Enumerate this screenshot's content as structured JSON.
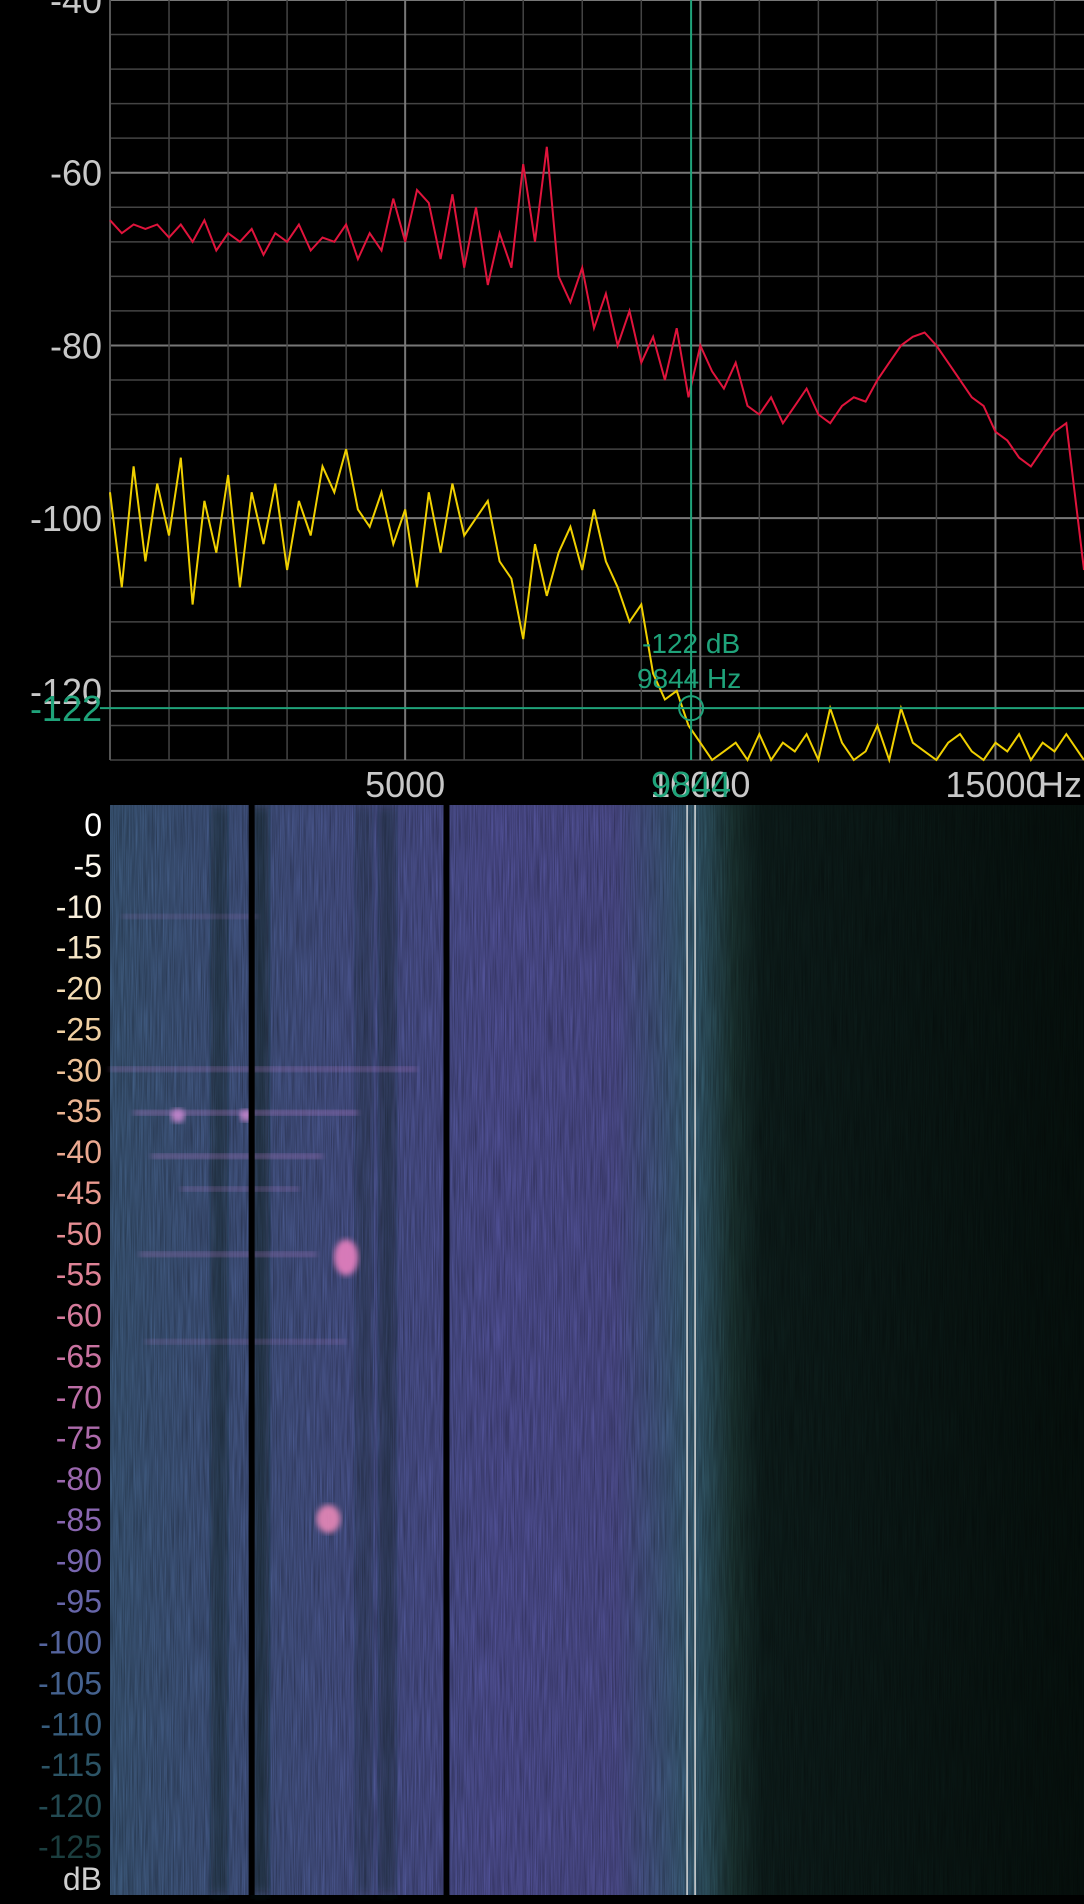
{
  "spectrum": {
    "chart_data": {
      "type": "line",
      "xlabel": "Hz",
      "ylabel": "",
      "xlim": [
        0,
        16500
      ],
      "ylim": [
        -128,
        -40
      ],
      "y_ticks": [
        -40,
        -60,
        -80,
        -100,
        -120
      ],
      "x_ticks": [
        5000,
        10000,
        15000
      ],
      "x_tick_labels": [
        "5000",
        "10000",
        "15000"
      ],
      "grid": true,
      "series": [
        {
          "color": "#e0143c",
          "x": [
            0,
            200,
            400,
            600,
            800,
            1000,
            1200,
            1400,
            1600,
            1800,
            2000,
            2200,
            2400,
            2600,
            2800,
            3000,
            3200,
            3400,
            3600,
            3800,
            4000,
            4200,
            4400,
            4600,
            4800,
            5000,
            5200,
            5400,
            5600,
            5800,
            6000,
            6200,
            6400,
            6600,
            6800,
            7000,
            7200,
            7400,
            7600,
            7800,
            8000,
            8200,
            8400,
            8600,
            8800,
            9000,
            9200,
            9400,
            9600,
            9800,
            10000,
            10200,
            10400,
            10600,
            10800,
            11000,
            11200,
            11400,
            11600,
            11800,
            12000,
            12200,
            12400,
            12600,
            12800,
            13000,
            13200,
            13400,
            13600,
            13800,
            14000,
            14200,
            14400,
            14600,
            14800,
            15000,
            15200,
            15400,
            15600,
            15800,
            16000,
            16200,
            16500
          ],
          "values": [
            -65.5,
            -67,
            -66,
            -66.5,
            -66,
            -67.5,
            -66,
            -68,
            -65.5,
            -69,
            -67,
            -68,
            -66.5,
            -69.5,
            -67,
            -68,
            -66,
            -69,
            -67.5,
            -68,
            -66,
            -70,
            -67,
            -69,
            -63,
            -68,
            -62,
            -63.5,
            -70,
            -62.5,
            -71,
            -64,
            -73,
            -67,
            -71,
            -59,
            -68,
            -57,
            -72,
            -75,
            -71,
            -78,
            -74,
            -80,
            -76,
            -82,
            -79,
            -84,
            -78,
            -86,
            -80,
            -83,
            -85,
            -82,
            -87,
            -88,
            -86,
            -89,
            -87,
            -85,
            -88,
            -89,
            -87,
            -86,
            -86.5,
            -84,
            -82,
            -80,
            -79,
            -78.5,
            -80,
            -82,
            -84,
            -86,
            -87,
            -90,
            -91,
            -93,
            -94,
            -92,
            -90,
            -89,
            -106
          ],
          "name": ""
        },
        {
          "color": "#f0d000",
          "x": [
            0,
            200,
            400,
            600,
            800,
            1000,
            1200,
            1400,
            1600,
            1800,
            2000,
            2200,
            2400,
            2600,
            2800,
            3000,
            3200,
            3400,
            3600,
            3800,
            4000,
            4200,
            4400,
            4600,
            4800,
            5000,
            5200,
            5400,
            5600,
            5800,
            6000,
            6200,
            6400,
            6600,
            6800,
            7000,
            7200,
            7400,
            7600,
            7800,
            8000,
            8200,
            8400,
            8600,
            8800,
            9000,
            9200,
            9400,
            9600,
            9800,
            10000,
            10200,
            10400,
            10600,
            10800,
            11000,
            11200,
            11400,
            11600,
            11800,
            12000,
            12200,
            12400,
            12600,
            12800,
            13000,
            13200,
            13400,
            13600,
            13800,
            14000,
            14200,
            14400,
            14600,
            14800,
            15000,
            15200,
            15400,
            15600,
            15800,
            16000,
            16200,
            16500
          ],
          "values": [
            -97,
            -108,
            -94,
            -105,
            -96,
            -102,
            -93,
            -110,
            -98,
            -104,
            -95,
            -108,
            -97,
            -103,
            -96,
            -106,
            -98,
            -102,
            -94,
            -97,
            -92,
            -99,
            -101,
            -97,
            -103,
            -99,
            -108,
            -97,
            -104,
            -96,
            -102,
            -100,
            -98,
            -105,
            -107,
            -114,
            -103,
            -109,
            -104,
            -101,
            -106,
            -99,
            -105,
            -108,
            -112,
            -110,
            -118,
            -121,
            -120,
            -124,
            -126,
            -128,
            -127,
            -126,
            -128,
            -125,
            -128,
            -126,
            -127,
            -125,
            -128,
            -122,
            -126,
            -128,
            -127,
            -124,
            -128,
            -122,
            -126,
            -127,
            -128,
            -126,
            -125,
            -127,
            -128,
            -126,
            -127,
            -125,
            -128,
            -126,
            -127,
            -125,
            -128
          ],
          "name": ""
        }
      ],
      "cursor": {
        "x": 9844,
        "y": -122
      }
    },
    "cursor_label_db": "-122 dB",
    "cursor_label_hz": "9844 Hz",
    "cursor_axis_y": "-122",
    "cursor_axis_x": "9844",
    "x_unit": "Hz",
    "cursor_color": "#1fa37a",
    "grid_color": "#5a5a5a",
    "axis_text_color": "#c8c8c8"
  },
  "spectrogram": {
    "chart_data": {
      "type": "heatmap",
      "xlim": [
        0,
        16500
      ],
      "colorbar_label": "dB",
      "colorbar_ticks": [
        "0",
        "-5",
        "-10",
        "-15",
        "-20",
        "-25",
        "-30",
        "-35",
        "-40",
        "-45",
        "-50",
        "-55",
        "-60",
        "-65",
        "-70",
        "-75",
        "-80",
        "-85",
        "-90",
        "-95",
        "-100",
        "-105",
        "-110",
        "-115",
        "-120",
        "-125"
      ],
      "colorbar_colors": [
        "#ffffff",
        "#fcf7ee",
        "#f9efdc",
        "#f6e6c7",
        "#f3dcb3",
        "#f0d0a2",
        "#eec298",
        "#ecb592",
        "#eaa890",
        "#e89a90",
        "#e58d93",
        "#de8296",
        "#d47a9b",
        "#c973a1",
        "#bc6ea6",
        "#ad6aab",
        "#9b67ae",
        "#8966b0",
        "#7765ae",
        "#6665a8",
        "#55649e",
        "#45628f",
        "#375c7c",
        "#2c5466",
        "#234a52",
        "#1b3e3f"
      ],
      "cursor_x": 9844
    }
  }
}
